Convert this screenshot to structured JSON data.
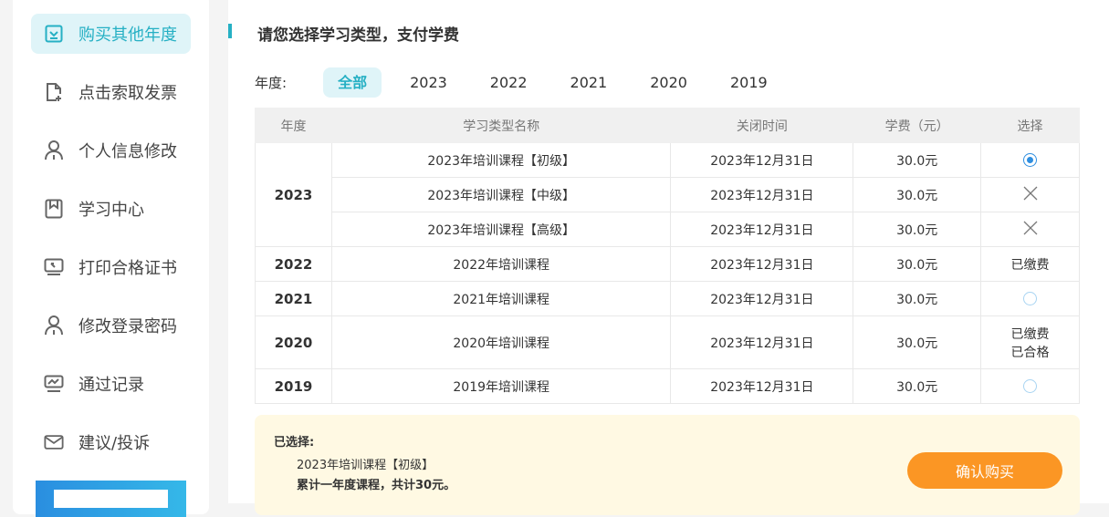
{
  "sidebar": {
    "items": [
      {
        "label": "购买其他年度",
        "icon": "checkbox-icon"
      },
      {
        "label": "点击索取发票",
        "icon": "file-add-icon"
      },
      {
        "label": "个人信息修改",
        "icon": "user-icon"
      },
      {
        "label": "学习中心",
        "icon": "bookmark-icon"
      },
      {
        "label": "打印合格证书",
        "icon": "monitor-icon"
      },
      {
        "label": "修改登录密码",
        "icon": "user-icon"
      },
      {
        "label": "通过记录",
        "icon": "chart-monitor-icon"
      },
      {
        "label": "建议/投诉",
        "icon": "mail-icon"
      }
    ]
  },
  "main": {
    "title": "请您选择学习类型，支付学费",
    "year_label": "年度:",
    "year_tabs": [
      "全部",
      "2023",
      "2022",
      "2021",
      "2020",
      "2019"
    ],
    "table": {
      "headers": [
        "年度",
        "学习类型名称",
        "关闭时间",
        "学费（元）",
        "选择"
      ],
      "rows": [
        {
          "year": "2023",
          "name": "2023年培训课程【初级】",
          "close": "2023年12月31日",
          "fee": "30.0元"
        },
        {
          "name": "2023年培训课程【中级】",
          "close": "2023年12月31日",
          "fee": "30.0元"
        },
        {
          "name": "2023年培训课程【高级】",
          "close": "2023年12月31日",
          "fee": "30.0元"
        },
        {
          "year": "2022",
          "name": "2022年培训课程",
          "close": "2023年12月31日",
          "fee": "30.0元",
          "status": "已缴费"
        },
        {
          "year": "2021",
          "name": "2021年培训课程",
          "close": "2023年12月31日",
          "fee": "30.0元"
        },
        {
          "year": "2020",
          "name": "2020年培训课程",
          "close": "2023年12月31日",
          "fee": "30.0元",
          "status": "已缴费",
          "status2": "已合格"
        },
        {
          "year": "2019",
          "name": "2019年培训课程",
          "close": "2023年12月31日",
          "fee": "30.0元"
        }
      ]
    },
    "summary": {
      "heading": "已选择:",
      "course": "2023年培训课程【初级】",
      "total": "累计一年度课程，共计30元。",
      "button": "确认购买"
    }
  }
}
